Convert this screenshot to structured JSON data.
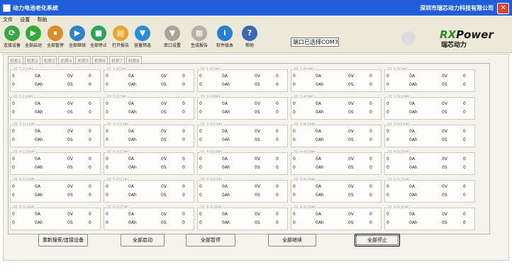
{
  "window": {
    "title": "动力电池老化系统",
    "company": "深圳市瑞芯动力科技有限公司",
    "close": "✕"
  },
  "menu": [
    "文件",
    "设置",
    "帮助"
  ],
  "toolbar": {
    "buttons": [
      {
        "label": "连接设备",
        "icon": "connect-icon",
        "color": "#3aa648",
        "glyph": "⟳"
      },
      {
        "label": "全部启动",
        "icon": "play-icon",
        "color": "#35a83a",
        "glyph": "▶"
      },
      {
        "label": "全部暂停",
        "icon": "pause-icon",
        "color": "#d98c2a",
        "glyph": "⏸"
      },
      {
        "label": "全部继续",
        "icon": "resume-icon",
        "color": "#2f83c8",
        "glyph": "▶"
      },
      {
        "label": "全部停止",
        "icon": "stop-icon",
        "color": "#2aa65a",
        "glyph": "■"
      },
      {
        "label": "打开报告",
        "icon": "open-folder-icon",
        "color": "#e3a92a",
        "glyph": "▤"
      },
      {
        "label": "容量筛选",
        "icon": "filter-icon",
        "color": "#2b8fd6",
        "glyph": "▼"
      },
      {
        "label": "串口设置",
        "icon": "serial-port-icon",
        "color": "#a7a49a",
        "glyph": "▼"
      },
      {
        "label": "生成报告",
        "icon": "report-icon",
        "color": "#b3b0a4",
        "glyph": "▦"
      },
      {
        "label": "软件版本",
        "icon": "info-icon",
        "color": "#2a7ed2",
        "glyph": "i"
      },
      {
        "label": "帮助",
        "icon": "help-icon",
        "color": "#3a68b5",
        "glyph": "?"
      }
    ],
    "port_status": "端口已选择COM3"
  },
  "logo": {
    "brand_prefix": "RX",
    "brand_suffix": "Power",
    "sub": "瑞芯动力"
  },
  "machine_tabs": [
    "机柜1",
    "机柜2",
    "机柜3",
    "机柜4",
    "机柜5",
    "机柜6",
    "机柜7",
    "机柜8"
  ],
  "grid": {
    "rows": [
      [
        {
          "title": "01 1-1(1#)"
        },
        {
          "title": "01 1-2(2#)"
        },
        {
          "title": "01 1-3(3#)"
        },
        {
          "title": "01 1-4(4#)"
        },
        {
          "title": "01 1-5(5#)"
        }
      ],
      [
        {
          "title": "01 2-1(6#)"
        },
        {
          "title": "01 2-2(7#)"
        },
        {
          "title": "01 2-3(8#)"
        },
        {
          "title": "01 2-4(9#)"
        },
        {
          "title": "01 2-5(10#)"
        }
      ],
      [
        {
          "title": "01 3-1(11#)"
        },
        {
          "title": "01 3-2(12#)"
        },
        {
          "title": "01 3-3(13#)"
        },
        {
          "title": "01 3-4(14#)"
        },
        {
          "title": "01 3-5(15#)"
        }
      ],
      [
        {
          "title": "01 4-1(16#)"
        },
        {
          "title": "01 4-2(17#)"
        },
        {
          "title": "01 4-3(18#)"
        },
        {
          "title": "01 4-4(19#)"
        },
        {
          "title": "01 4-5(20#)"
        }
      ],
      [
        {
          "title": "01 5-1(21#)"
        },
        {
          "title": "01 5-2(22#)"
        },
        {
          "title": "01 5-3(23#)"
        },
        {
          "title": "01 5-4(24#)"
        },
        {
          "title": "01 5-5(25#)"
        }
      ],
      [
        {
          "title": "01 6-1(26#)"
        },
        {
          "title": "01 6-2(27#)"
        },
        {
          "title": "01 6-3(28#)"
        },
        {
          "title": "01 6-4(29#)"
        },
        {
          "title": "01 6-5(30#)"
        }
      ]
    ],
    "line1": [
      "0",
      "0A",
      "0V",
      "0"
    ],
    "line2": [
      "0",
      "0Ah",
      "0S",
      "0"
    ]
  },
  "bottom_buttons": [
    {
      "label": "重新搜索/连接设备",
      "name": "rescan-connect-button"
    },
    {
      "label": "全部启动",
      "name": "start-all-button"
    },
    {
      "label": "全部暂停",
      "name": "pause-all-button"
    },
    {
      "label": "全部继续",
      "name": "resume-all-button"
    },
    {
      "label": "全部停止",
      "name": "stop-all-button"
    }
  ]
}
